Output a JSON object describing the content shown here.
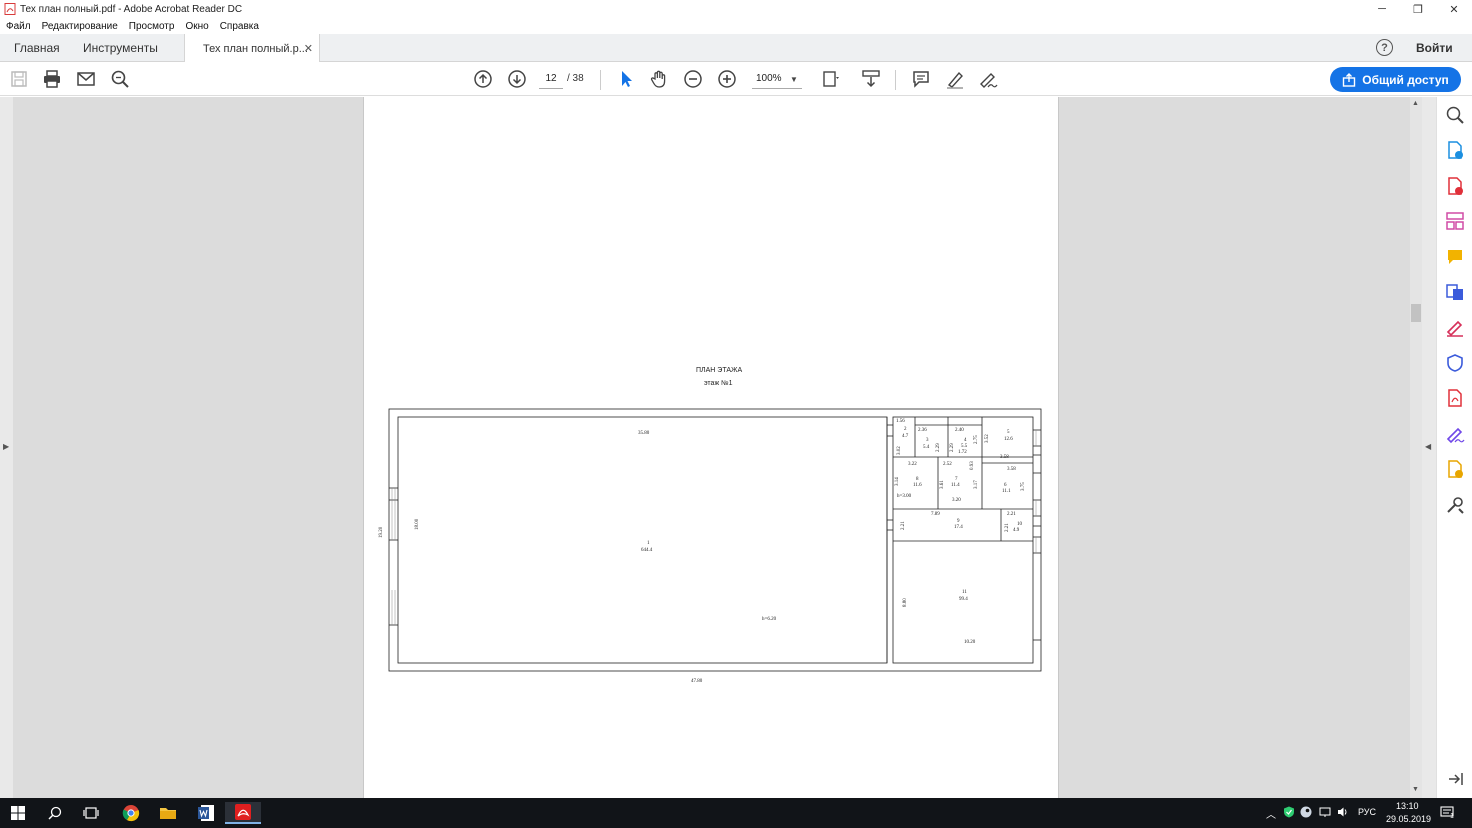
{
  "window": {
    "title": "Тех план полный.pdf - Adobe Acrobat Reader DC",
    "controls": [
      "─",
      "❐",
      "✕"
    ]
  },
  "menu": [
    "Файл",
    "Редактирование",
    "Просмотр",
    "Окно",
    "Справка"
  ],
  "tabs": {
    "home": "Главная",
    "tools": "Инструменты",
    "document": "Тех план полный.p...",
    "close": "✕"
  },
  "header": {
    "help": "?",
    "signin": "Войти"
  },
  "toolbar": {
    "current_page": "12",
    "page_total": "/ 38",
    "zoom": "100%",
    "share_label": "Общий доступ"
  },
  "floor_plan": {
    "title": "ПЛАН ЭТАЖА",
    "subtitle": "этаж №1",
    "labels": {
      "total_width": "47.80",
      "total_height": "19.20",
      "hall_width": "35.80",
      "hall_height": "18.00",
      "room1_num": "1",
      "room1_area": "644.4",
      "hall_ceiling": "h=6.20",
      "r2_w": "1.56",
      "r2_num": "2",
      "r2_area": "4.7",
      "r2_h": "3.02",
      "r3_w": "2.36",
      "r3_num": "3",
      "r3_area": "5.4",
      "r3_h": "2.29",
      "r4_w": "2.40",
      "r4_num": "4",
      "r4_area": "5.5",
      "r4_h": "2.29",
      "r4_b": "1.72",
      "r4_d": "2.75",
      "r4_d2": "0.93",
      "r5_h": "3.52",
      "r5_num": "5",
      "r5_area": "12.6",
      "r5_w": "3.58",
      "r6_w": "3.58",
      "r6_num": "6",
      "r6_area": "11.1",
      "r6_h": "3.75",
      "r7_w": "2.52",
      "r7_num": "7",
      "r7_area": "11.4",
      "r7_h": "3.61",
      "r7_h2": "3.17",
      "r7_b": "3.20",
      "r8_w": "3.22",
      "r8_num": "8",
      "r8_area": "11.6",
      "r8_h": "3.14",
      "r8_ceiling": "h=3.00",
      "r9_w": "7.89",
      "r9_num": "9",
      "r9_area": "17.4",
      "r9_h": "2.21",
      "r10_w": "2.21",
      "r10_num": "10",
      "r10_area": "4.9",
      "r10_h": "2.21",
      "r11_num": "11",
      "r11_area": "99.4",
      "r11_h": "8.80",
      "r11_w": "10.20"
    }
  },
  "taskbar": {
    "lang": "РУС",
    "time": "13:10",
    "date": "29.05.2019",
    "notif_count": "1"
  },
  "colors": {
    "accent": "#1473e6",
    "acrobat_red": "#e01f1f",
    "taskbar": "#111418"
  }
}
